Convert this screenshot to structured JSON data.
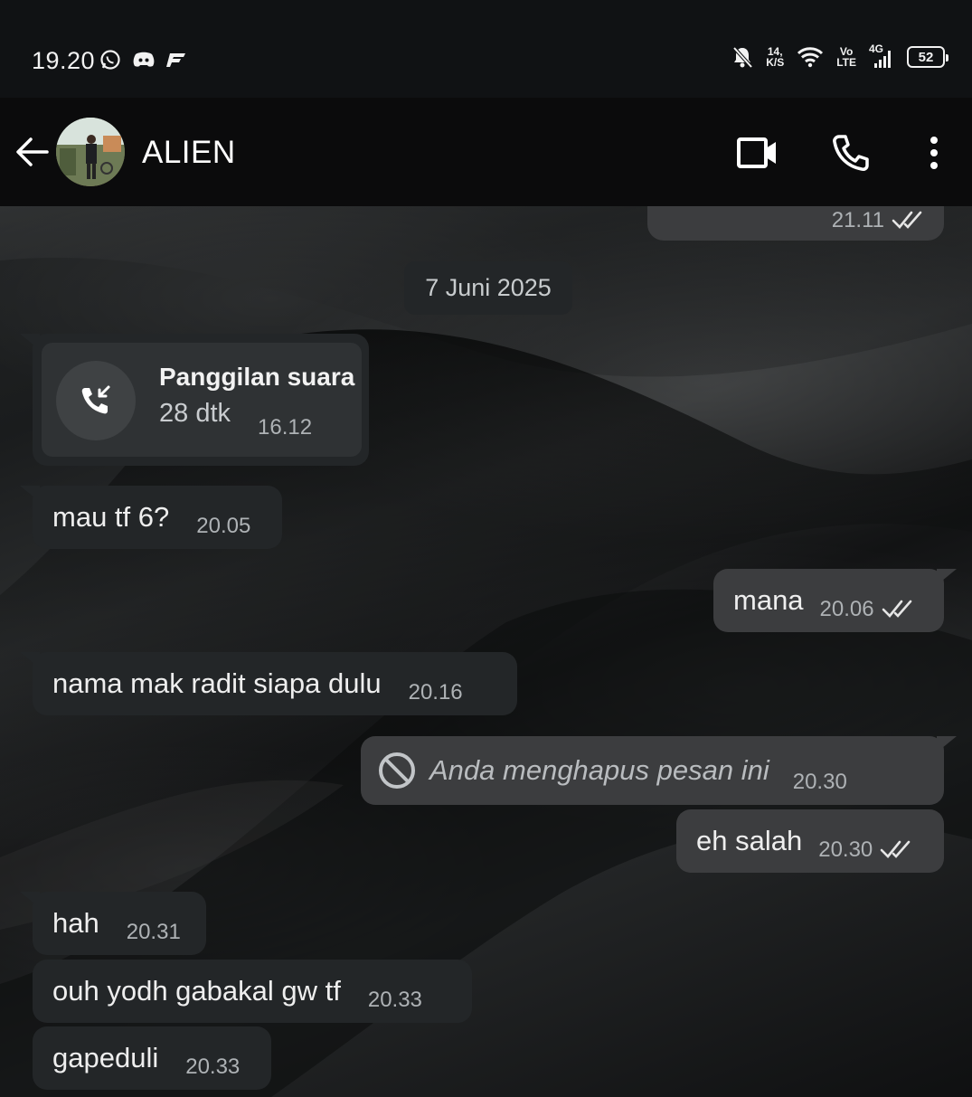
{
  "status_bar": {
    "time": "19.20",
    "net_speed_top": "14,",
    "net_speed_bottom": "K/S",
    "volte_top": "Vo",
    "volte_bottom": "LTE",
    "network_type": "4G",
    "battery": "52"
  },
  "header": {
    "contact_name": "ALIEN"
  },
  "messages": {
    "prev_out": {
      "time": "21.11"
    },
    "date_chip": "7 Juni 2025",
    "call": {
      "title": "Panggilan suara",
      "duration": "28 dtk",
      "time": "16.12"
    },
    "m1": {
      "text": "mau tf 6?",
      "time": "20.05"
    },
    "m2": {
      "text": "mana",
      "time": "20.06"
    },
    "m3": {
      "text": "nama mak radit siapa dulu",
      "time": "20.16"
    },
    "m4": {
      "text": "Anda menghapus pesan ini",
      "time": "20.30"
    },
    "m5": {
      "text": "eh salah",
      "time": "20.30"
    },
    "m6": {
      "text": "hah",
      "time": "20.31"
    },
    "m7": {
      "text": "ouh yodh gabakal gw tf",
      "time": "20.33"
    },
    "m8": {
      "text": "gapeduli",
      "time": "20.33"
    }
  },
  "colors": {
    "incoming_bubble": "#232628",
    "outgoing_bubble": "#3c3d3f",
    "header_bg": "#0b0b0c",
    "read_ticks": "#e6e6e6"
  }
}
